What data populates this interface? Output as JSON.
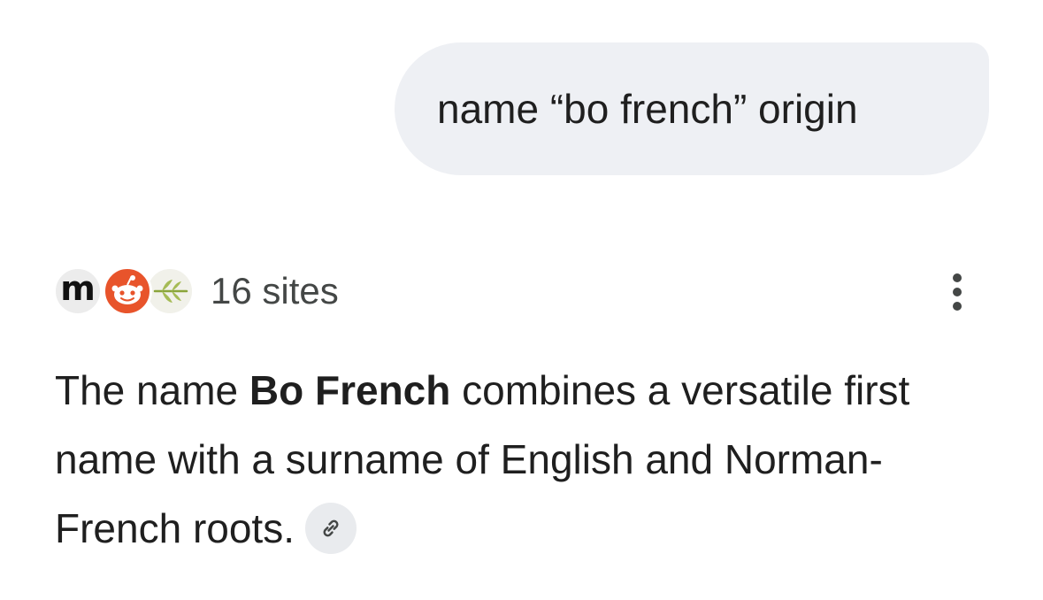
{
  "query": {
    "text": "name “bo french” origin"
  },
  "sources": {
    "count_label": "16 sites",
    "favicons": [
      "m-logo-icon",
      "reddit-icon",
      "leaf-icon"
    ],
    "m_letter": "m"
  },
  "menu": {
    "icon": "more-vert-icon"
  },
  "answer": {
    "prefix": "The name ",
    "bold": "Bo French",
    "suffix": " combines a versatile first name with a surname of English and Norman-French roots.",
    "link_icon": "link-icon"
  },
  "colors": {
    "bubble_bg": "#eef0f4",
    "text": "#1f1f1f",
    "muted_text": "#444746",
    "reddit_orange": "#e8542b",
    "chip_bg": "#e9ebee"
  }
}
